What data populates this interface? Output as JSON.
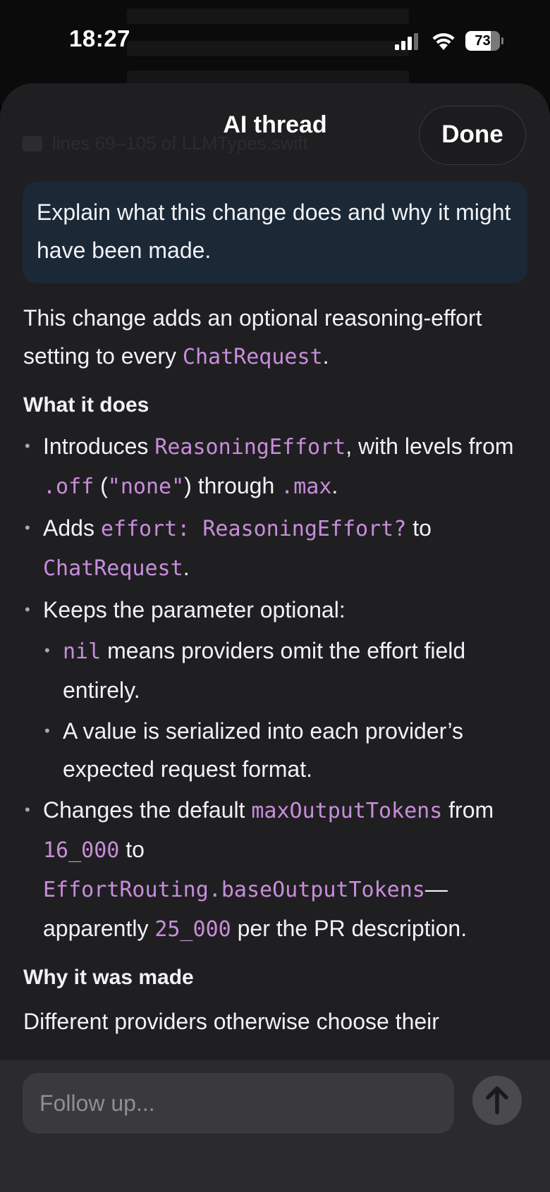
{
  "status_bar": {
    "time": "18:27",
    "battery_percent": "73",
    "battery_level": 0.73
  },
  "sheet": {
    "title": "AI thread",
    "done_label": "Done",
    "behind_caption": "lines 69–105 of LLMTypes.swift"
  },
  "prompt": {
    "text": "Explain what this change does and why it might have been made."
  },
  "answer": {
    "intro_pre": "This change adds an optional reasoning-effort setting to every ",
    "intro_code": "ChatRequest",
    "intro_post": ".",
    "heading_what": "What it does",
    "b1_pre": "Introduces ",
    "b1_code1": "ReasoningEffort",
    "b1_mid1": ", with levels from ",
    "b1_code2": ".off",
    "b1_mid2": " (",
    "b1_code3": "\"none\"",
    "b1_mid3": ") through ",
    "b1_code4": ".max",
    "b1_post": ".",
    "b2_pre": "Adds ",
    "b2_code1": "effort: ReasoningEffort?",
    "b2_mid": " to ",
    "b2_code2": "ChatRequest",
    "b2_post": ".",
    "b3_text": "Keeps the parameter optional:",
    "b3a_code": "nil",
    "b3a_text": " means providers omit the effort field entirely.",
    "b3b_text": "A value is serialized into each provider’s expected request format.",
    "b4_pre": "Changes the default ",
    "b4_code1": "maxOutputTokens",
    "b4_mid1": " from ",
    "b4_code2": "16_000",
    "b4_mid2": " to ",
    "b4_code3": "EffortRouting.baseOutputTokens",
    "b4_mid3": "—apparently ",
    "b4_code4": "25_000",
    "b4_post": " per the PR description.",
    "heading_why": "Why it was made",
    "why_text": "Different providers otherwise choose their"
  },
  "composer": {
    "placeholder": "Follow up..."
  },
  "colors": {
    "code": "#c88ddb",
    "sheet_bg": "#1f1f21",
    "prompt_bg": "#1b2836"
  },
  "icons": [
    "signal-icon",
    "wifi-icon",
    "battery-icon",
    "document-icon",
    "arrow-up-icon"
  ]
}
